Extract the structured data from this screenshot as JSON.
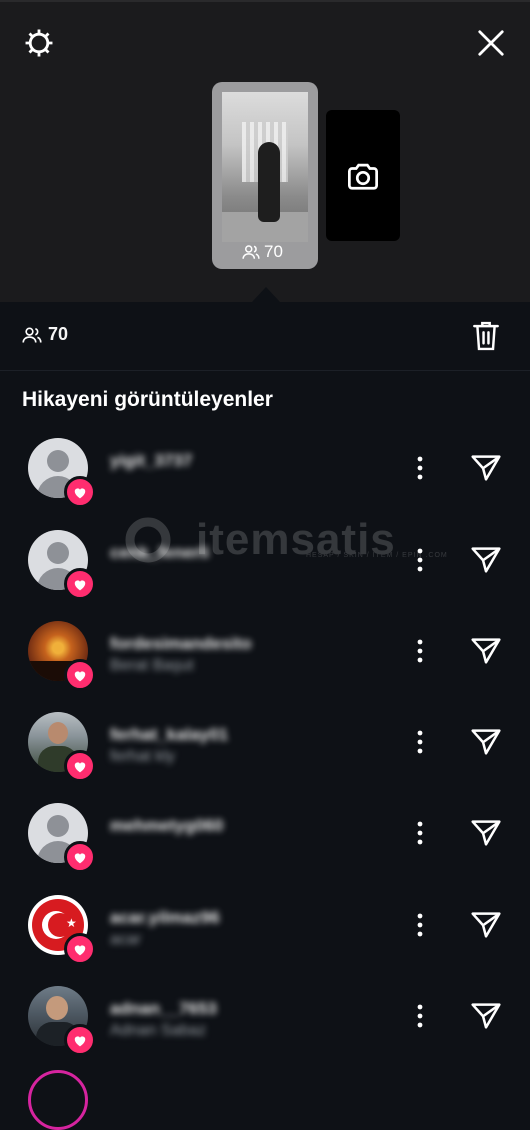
{
  "story": {
    "viewer_count": "70"
  },
  "stats": {
    "viewer_count": "70"
  },
  "section": {
    "title": "Hikayeni görüntüleyenler"
  },
  "viewers": [
    {
      "username": "yigit_3737",
      "full_name": "",
      "avatar": "default"
    },
    {
      "username": "cenk_fenerli",
      "full_name": "",
      "avatar": "default"
    },
    {
      "username": "fordesimandesito",
      "full_name": "Berat Başut",
      "avatar": "sunset"
    },
    {
      "username": "ferhat_kalay01",
      "full_name": "ferhat kly",
      "avatar": "photo"
    },
    {
      "username": "mehmetyg060",
      "full_name": "",
      "avatar": "default"
    },
    {
      "username": "acar.yilmaz96",
      "full_name": "acar",
      "avatar": "flag"
    },
    {
      "username": "adnan__7653",
      "full_name": "Adnan Sabaz",
      "avatar": "photo"
    }
  ],
  "watermark": {
    "brand": "itemsatis",
    "tagline": "HESAP / SKIN / ITEM / EPIN",
    "domain": ".COM"
  },
  "colors": {
    "background": "#0e1116",
    "top_panel": "#1b1b1d",
    "like_badge": "#ff2d6f"
  },
  "icons": {
    "settings": "gear-icon",
    "close": "close-icon",
    "camera": "camera-icon",
    "viewers": "viewers-icon",
    "delete": "trash-icon",
    "like": "heart-icon",
    "more": "more-vertical-icon",
    "send": "send-icon"
  }
}
